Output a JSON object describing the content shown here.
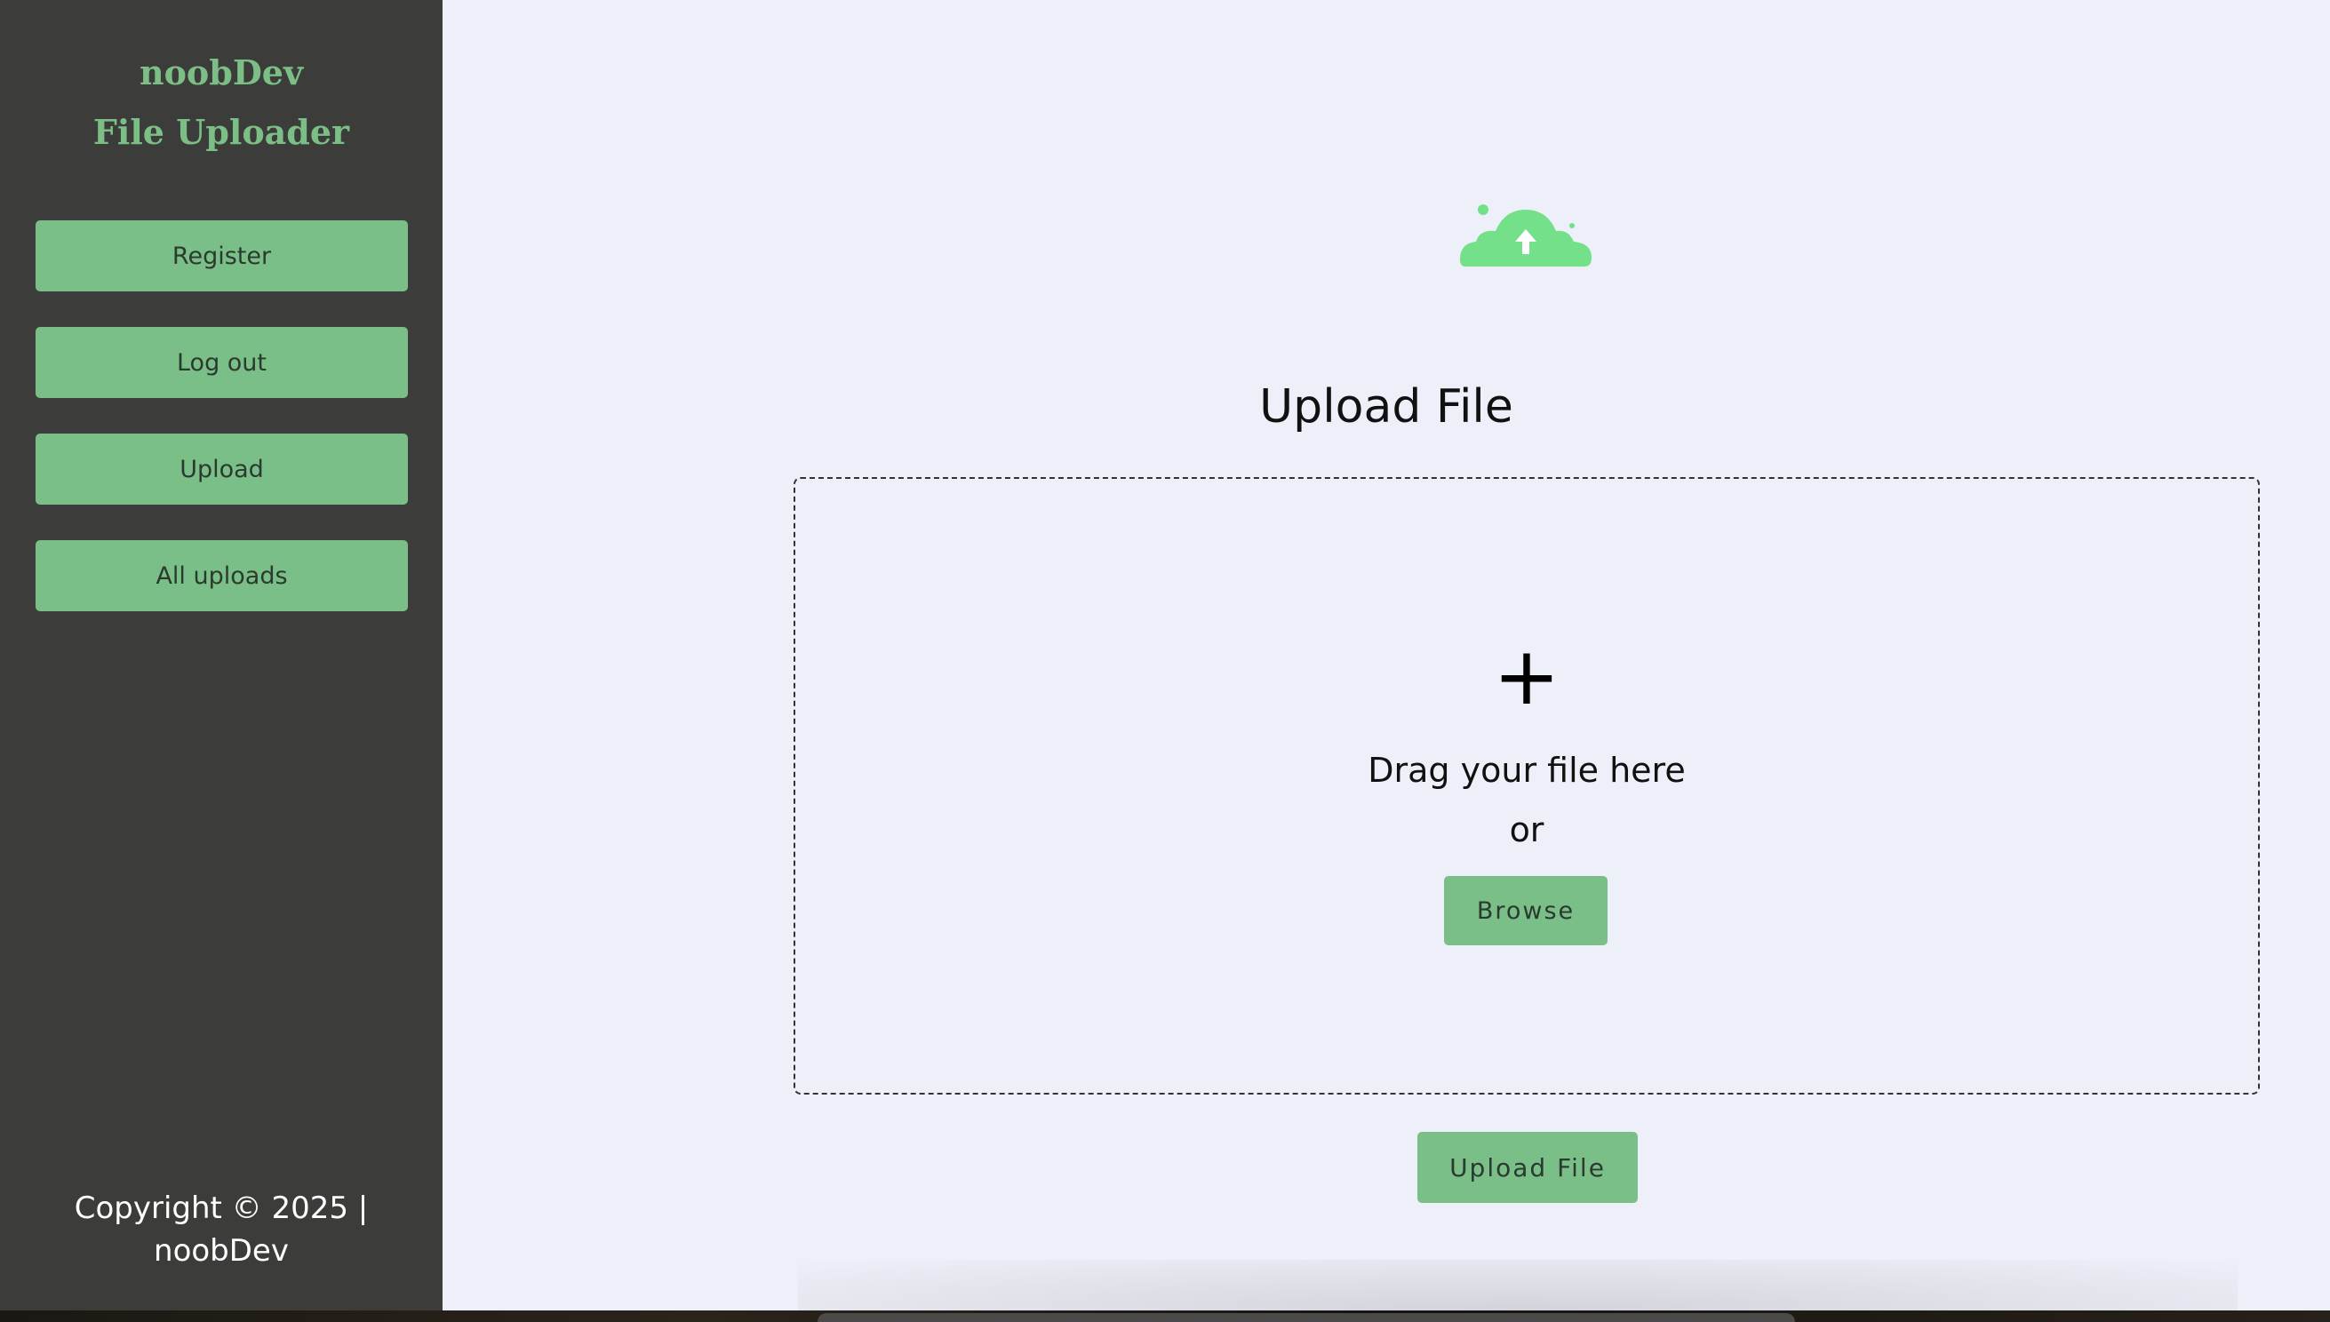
{
  "sidebar": {
    "brand": {
      "line1": "noobDev",
      "line2": "File Uploader"
    },
    "nav": [
      {
        "label": "Register"
      },
      {
        "label": "Log out"
      },
      {
        "label": "Upload"
      },
      {
        "label": "All uploads"
      }
    ],
    "copyright": {
      "line1": "Copyright © 2025 |",
      "line2": "noobDev"
    }
  },
  "main": {
    "icon": "cloud-upload-icon",
    "title": "Upload File",
    "dropzone": {
      "plus_icon": "+",
      "drag_text": "Drag your file here",
      "or_text": "or",
      "browse_label": "Browse"
    },
    "upload_button_label": "Upload File"
  },
  "colors": {
    "sidebar_bg": "#3c3d3b",
    "accent": "#7abf88",
    "brand_text": "#7cbf86",
    "main_bg": "#eef0f9",
    "cloud_icon": "#74e08a"
  }
}
